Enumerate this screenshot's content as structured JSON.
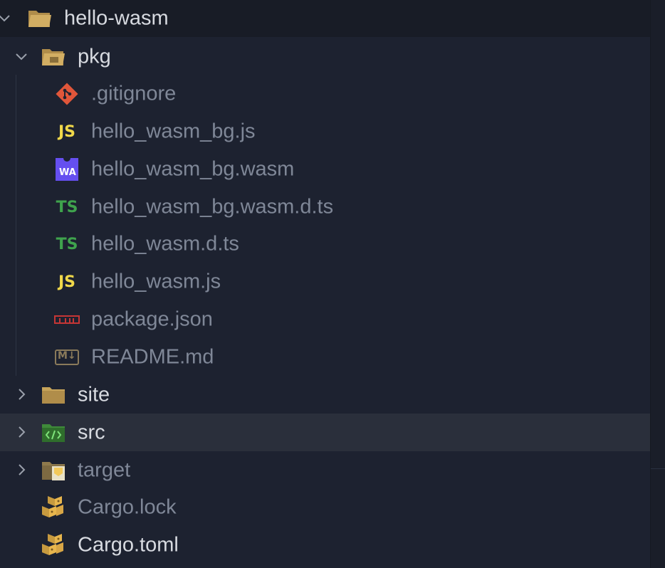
{
  "explorer": {
    "root": {
      "label": "hello-wasm",
      "icon": "folder-open-icon",
      "expanded": true
    },
    "items": [
      {
        "id": "pkg",
        "label": "pkg",
        "type": "folder",
        "expanded": true,
        "icon": "folder-open-icon",
        "dim": false
      },
      {
        "id": "gitignore",
        "label": ".gitignore",
        "type": "file",
        "icon": "git-icon",
        "dim": true
      },
      {
        "id": "bg-js",
        "label": "hello_wasm_bg.js",
        "type": "file",
        "icon": "javascript-icon",
        "dim": true
      },
      {
        "id": "bg-wasm",
        "label": "hello_wasm_bg.wasm",
        "type": "file",
        "icon": "webassembly-icon",
        "dim": true
      },
      {
        "id": "bg-wasm-dts",
        "label": "hello_wasm_bg.wasm.d.ts",
        "type": "file",
        "icon": "typescript-icon",
        "dim": true
      },
      {
        "id": "dts",
        "label": "hello_wasm.d.ts",
        "type": "file",
        "icon": "typescript-icon",
        "dim": true
      },
      {
        "id": "js",
        "label": "hello_wasm.js",
        "type": "file",
        "icon": "javascript-icon",
        "dim": true
      },
      {
        "id": "package-json",
        "label": "package.json",
        "type": "file",
        "icon": "npm-icon",
        "dim": true
      },
      {
        "id": "readme",
        "label": "README.md",
        "type": "file",
        "icon": "markdown-icon",
        "dim": true
      },
      {
        "id": "site",
        "label": "site",
        "type": "folder",
        "expanded": false,
        "icon": "folder-icon",
        "dim": false
      },
      {
        "id": "src",
        "label": "src",
        "type": "folder",
        "expanded": false,
        "icon": "folder-src-icon",
        "dim": false,
        "hovered": true
      },
      {
        "id": "target",
        "label": "target",
        "type": "folder",
        "expanded": false,
        "icon": "folder-target-icon",
        "dim": true
      },
      {
        "id": "cargo-lock",
        "label": "Cargo.lock",
        "type": "file",
        "icon": "cargo-icon",
        "dim": true
      },
      {
        "id": "cargo-toml",
        "label": "Cargo.toml",
        "type": "file",
        "icon": "cargo-icon",
        "dim": false
      }
    ],
    "icon_text": {
      "js": "JS",
      "ts": "TS",
      "wa": "WA",
      "md": "M↓"
    }
  },
  "colors": {
    "background": "#1d2230",
    "root_background": "#181c26",
    "hover_background": "#2a2f3b",
    "text_bright": "#d7dae0",
    "text_dim": "#7f8797",
    "folder": "#c7a45a",
    "js": "#f0d84a",
    "ts": "#3fa34d",
    "wasm": "#654ff0",
    "git": "#e0563a",
    "npm": "#c53635",
    "src_folder": "#3f8a3a"
  }
}
